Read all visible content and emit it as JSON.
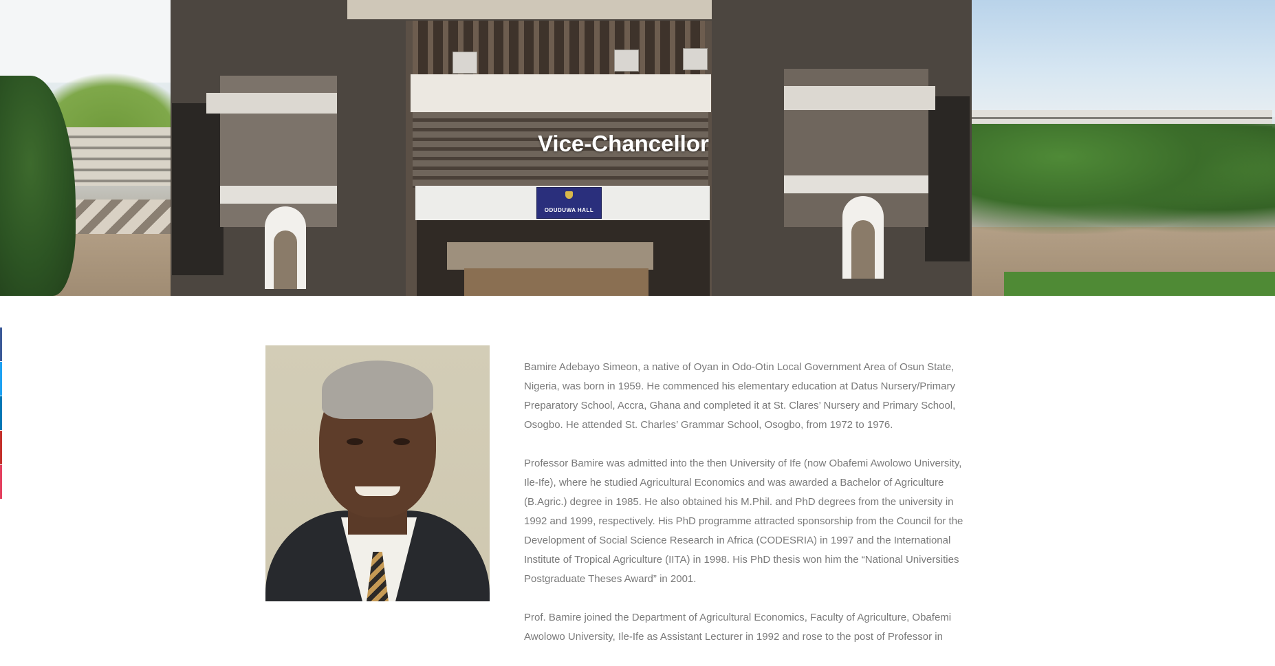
{
  "hero": {
    "title": "Vice-Chancellor",
    "sign_text": "ODUDUWA HALL"
  },
  "social": {
    "colors": [
      "#3b5998",
      "#1da1f2",
      "#0077b5",
      "#c4302b",
      "#e4405f"
    ],
    "items": [
      "facebook-icon",
      "twitter-icon",
      "linkedin-icon",
      "youtube-icon",
      "instagram-icon"
    ]
  },
  "bio": {
    "paragraphs": [
      "Bamire Adebayo Simeon, a native of Oyan in Odo-Otin Local Government Area of Osun State, Nigeria, was born in 1959. He commenced his elementary education at Datus Nursery/Primary Preparatory School, Accra, Ghana and completed it at St. Clares’ Nursery and Primary School, Osogbo. He attended St. Charles’ Grammar School, Osogbo, from 1972 to 1976.",
      "Professor Bamire was admitted into the then University of Ife (now Obafemi Awolowo University, Ile-Ife), where he studied Agricultural Economics and was awarded a Bachelor of Agriculture (B.Agric.) degree in 1985. He also obtained his M.Phil. and PhD degrees from the university in 1992 and 1999, respectively. His PhD programme attracted sponsorship from the Council for the Development of Social Science Research in Africa (CODESRIA) in 1997 and the International Institute of Tropical Agriculture (IITA) in 1998. His PhD thesis won him the “National Universities Postgraduate Theses Award” in 2001.",
      "Prof. Bamire joined the Department of Agricultural Economics, Faculty of Agriculture, Obafemi Awolowo University, Ile-Ife as Assistant Lecturer in 1992 and rose to the post of Professor in"
    ]
  }
}
